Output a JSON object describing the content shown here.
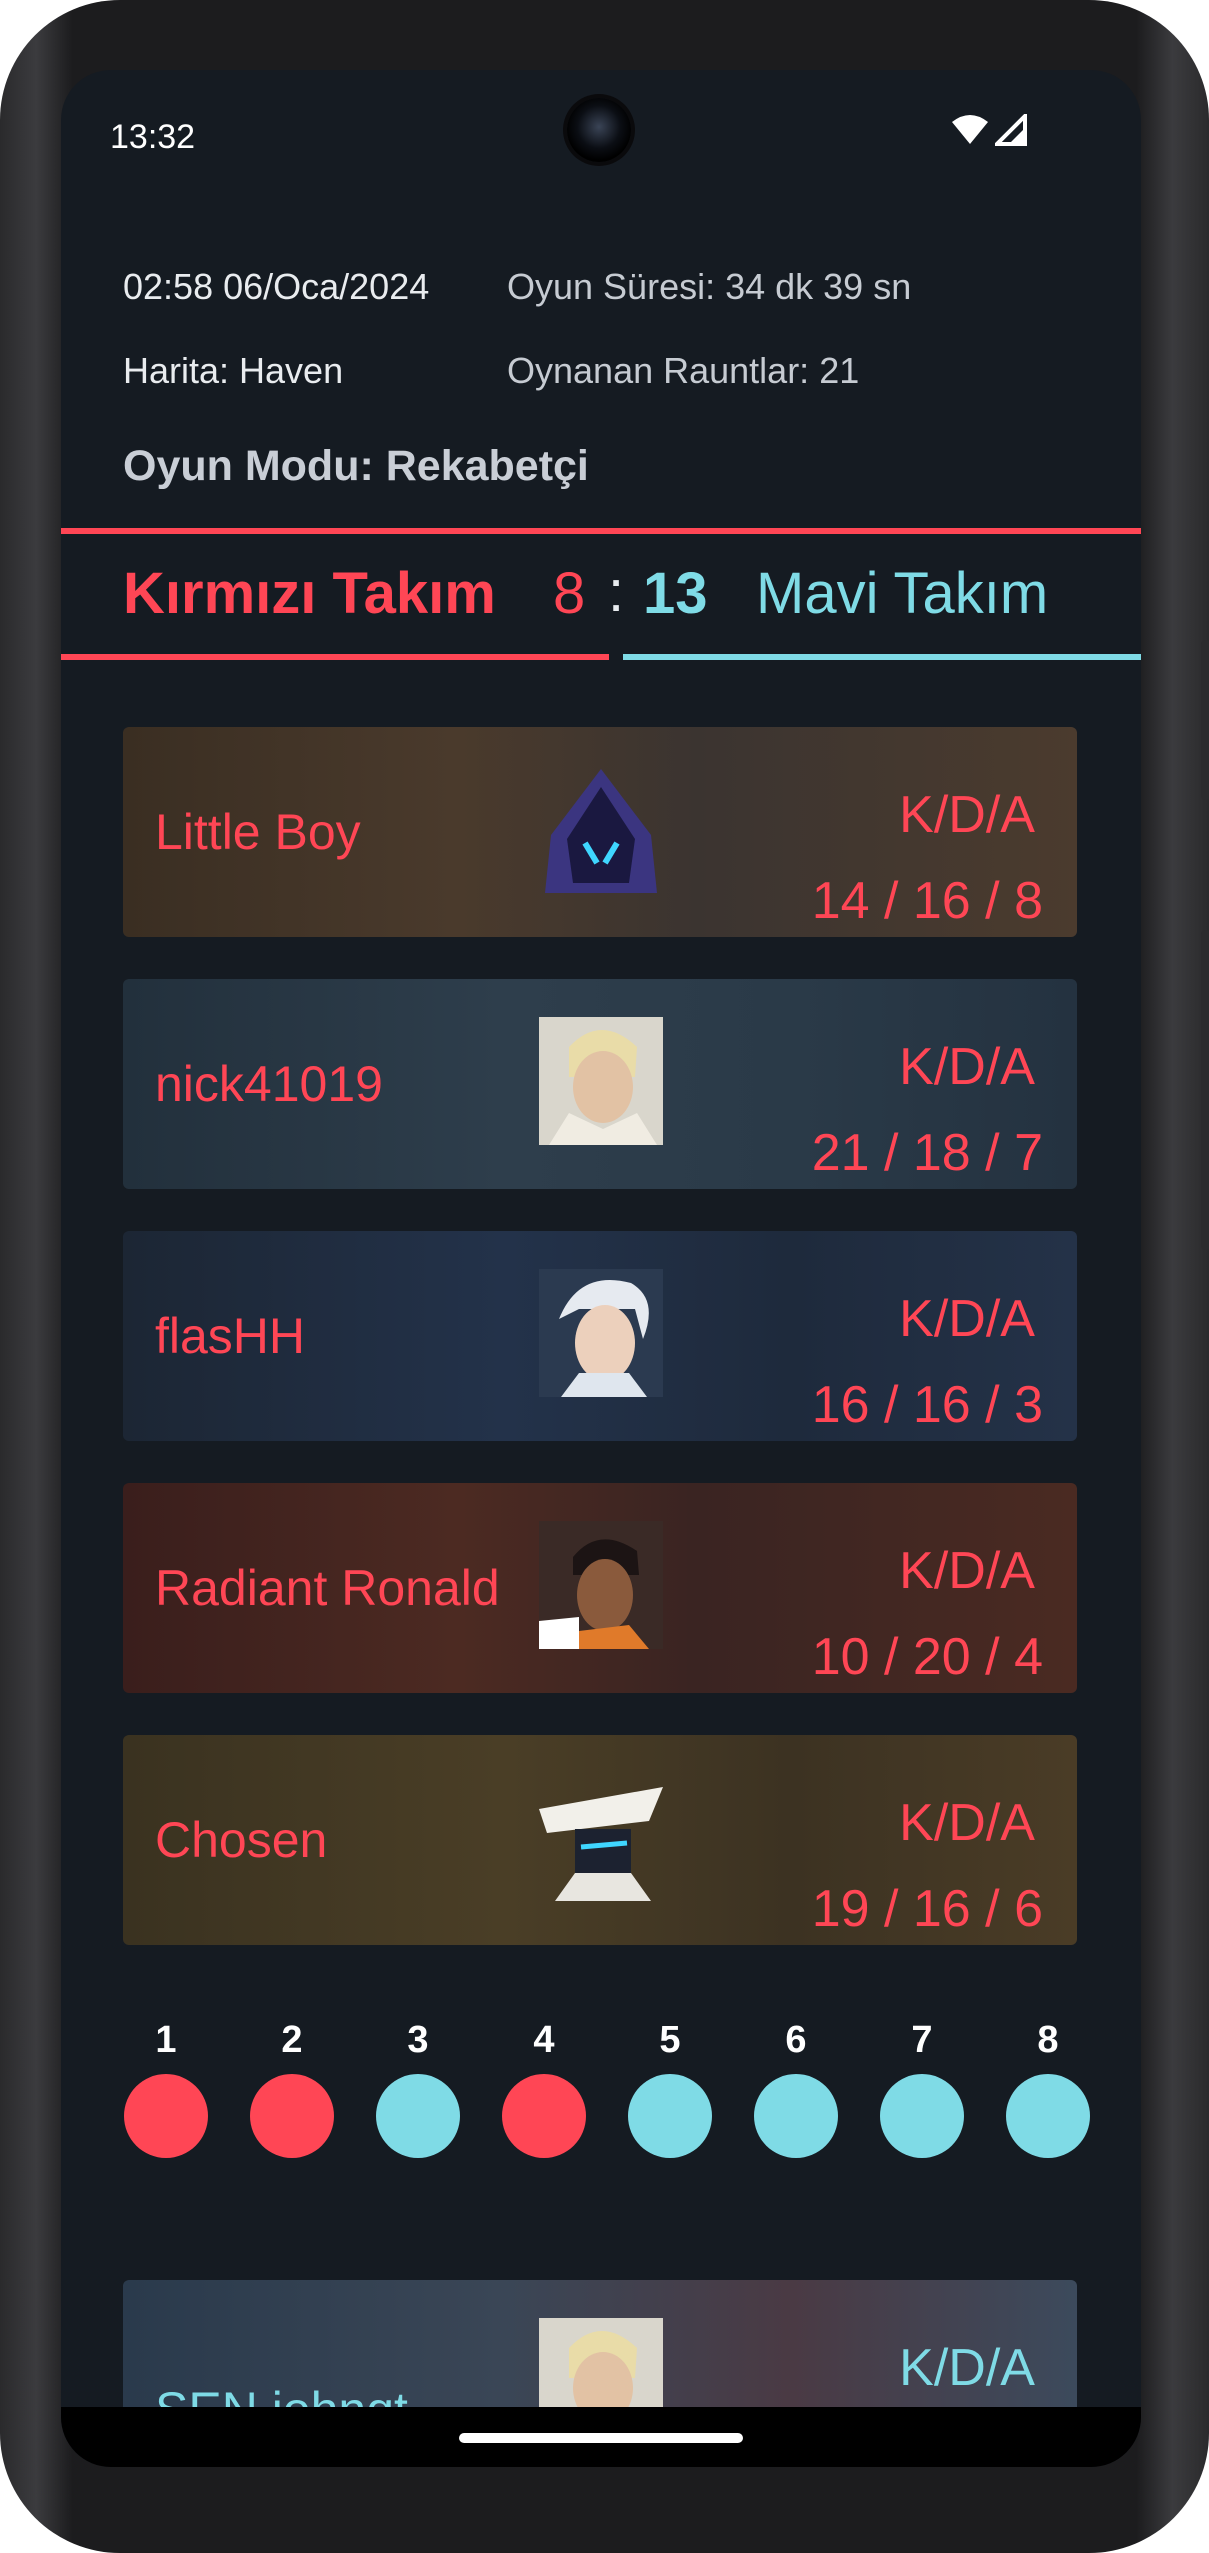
{
  "status_bar": {
    "time": "13:32",
    "wifi_icon": "wifi-icon",
    "signal_icon": "signal-icon"
  },
  "match": {
    "datetime": "02:58 06/Oca/2024",
    "duration": "Oyun Süresi: 34 dk 39 sn",
    "map": "Harita: Haven",
    "rounds_played": "Oynanan Rauntlar: 21",
    "mode": "Oyun Modu: Rekabetçi"
  },
  "score": {
    "red_team": "Kırmızı Takım",
    "red_score": "8",
    "separator": ":",
    "blue_score": "13",
    "blue_team": "Mavi Takım",
    "red_color": "#ff4655",
    "blue_color": "#7fdbe6"
  },
  "players": [
    {
      "name": "Little Boy",
      "kda_label": "K/D/A",
      "kda": "14 / 16 / 8",
      "team": "red",
      "agent_icon": "omen-agent-icon"
    },
    {
      "name": "nick41019",
      "kda_label": "K/D/A",
      "kda": "21 / 18 / 7",
      "team": "red",
      "agent_icon": "chamber-agent-icon"
    },
    {
      "name": "flasHH",
      "kda_label": "K/D/A",
      "kda": "16 / 16 / 3",
      "team": "red",
      "agent_icon": "jett-agent-icon"
    },
    {
      "name": "Radiant Ronald",
      "kda_label": "K/D/A",
      "kda": "10 / 20 / 4",
      "team": "red",
      "agent_icon": "phoenix-agent-icon"
    },
    {
      "name": "Chosen",
      "kda_label": "K/D/A",
      "kda": "19 / 16 / 6",
      "team": "red",
      "agent_icon": "cypher-agent-icon"
    },
    {
      "name": "SEN iohnqt",
      "kda_label": "K/D/A",
      "kda": "",
      "team": "blue",
      "agent_icon": "chamber-agent-icon"
    }
  ],
  "rounds": [
    {
      "number": "1",
      "winner": "red"
    },
    {
      "number": "2",
      "winner": "red"
    },
    {
      "number": "3",
      "winner": "blue"
    },
    {
      "number": "4",
      "winner": "red"
    },
    {
      "number": "5",
      "winner": "blue"
    },
    {
      "number": "6",
      "winner": "blue"
    },
    {
      "number": "7",
      "winner": "blue"
    },
    {
      "number": "8",
      "winner": "blue"
    }
  ]
}
